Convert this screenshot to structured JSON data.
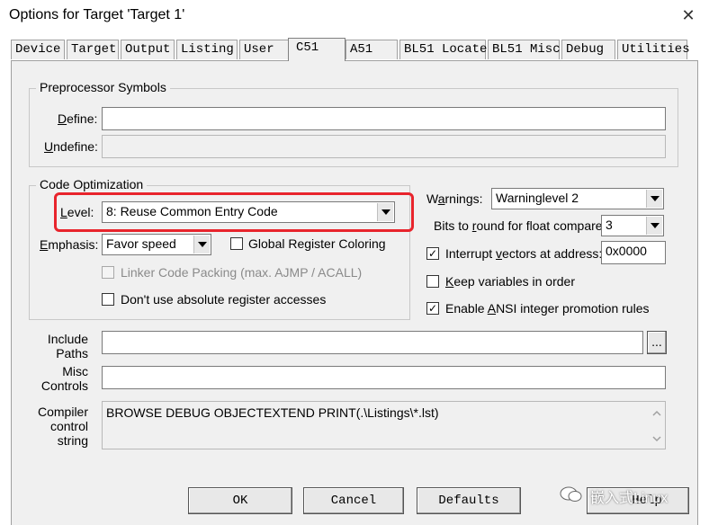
{
  "window": {
    "title": "Options for Target 'Target 1'",
    "close_glyph": "✕"
  },
  "tabs": [
    {
      "label": "Device"
    },
    {
      "label": "Target"
    },
    {
      "label": "Output"
    },
    {
      "label": "Listing"
    },
    {
      "label": "User"
    },
    {
      "label": "C51",
      "active": true
    },
    {
      "label": "A51"
    },
    {
      "label": "BL51 Locate"
    },
    {
      "label": "BL51 Misc"
    },
    {
      "label": "Debug"
    },
    {
      "label": "Utilities"
    }
  ],
  "preprocessor": {
    "legend": "Preprocessor Symbols",
    "define_label": "Define:",
    "define_value": "",
    "undefine_label": "Undefine:",
    "undefine_value": ""
  },
  "code_optimization": {
    "legend": "Code Optimization",
    "level_label": "Level:",
    "level_value": "8: Reuse Common Entry Code",
    "emphasis_label": "Emphasis:",
    "emphasis_value": "Favor speed",
    "global_register_coloring": {
      "label": "Global Register Coloring",
      "checked": false
    },
    "linker_code_packing": {
      "label": "Linker Code Packing (max. AJMP / ACALL)",
      "checked": false,
      "disabled": true
    },
    "dont_use_absolute": {
      "label": "Don't use absolute register accesses",
      "checked": false
    }
  },
  "right_options": {
    "warnings_label": "Warnings:",
    "warnings_value": "Warninglevel 2",
    "bits_label": "Bits to round for float compare:",
    "bits_value": "3",
    "interrupt_vectors": {
      "label": "Interrupt vectors at address:",
      "checked": true,
      "value": "0x0000"
    },
    "keep_variables": {
      "label": "Keep variables in order",
      "checked": false
    },
    "enable_ansi": {
      "label": "Enable ANSI integer promotion rules",
      "checked": true
    }
  },
  "paths": {
    "include_label_1": "Include",
    "include_label_2": "Paths",
    "include_value": "",
    "browse_label": "...",
    "misc_label_1": "Misc",
    "misc_label_2": "Controls",
    "misc_value": "",
    "compiler_label_1": "Compiler",
    "compiler_label_2": "control",
    "compiler_label_3": "string",
    "compiler_value": "BROWSE DEBUG OBJECTEXTEND PRINT(.\\Listings\\*.lst)"
  },
  "buttons": {
    "ok": "OK",
    "cancel": "Cancel",
    "defaults": "Defaults",
    "help": "Help"
  },
  "watermark": {
    "text": "嵌入式Linux"
  },
  "colors": {
    "highlight": "#e8242c",
    "dialog_bg": "#f0f0f0"
  }
}
